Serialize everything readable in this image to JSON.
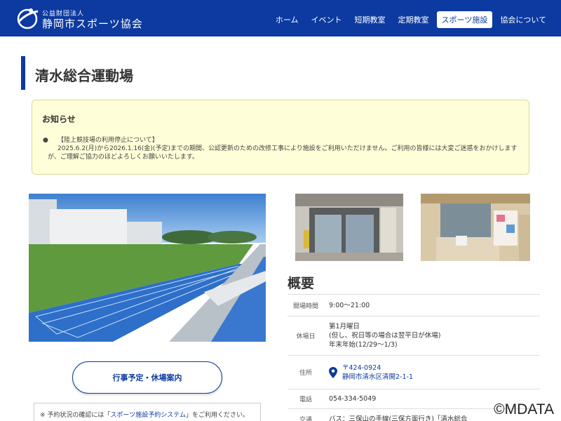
{
  "header": {
    "org_sub": "公益財団法人",
    "org_name": "静岡市スポーツ協会",
    "nav": [
      "ホーム",
      "イベント",
      "短期教室",
      "定期教室",
      "スポーツ施設",
      "協会について"
    ],
    "active_nav": "スポーツ施設"
  },
  "page": {
    "title": "清水総合運動場"
  },
  "notice": {
    "title": "お知らせ",
    "item_title": "【陸上競技場の利用停止について】",
    "item_line1": "2025.6.2(月)から2026.1.16(金)(予定)までの期間、公認更新のための改修工事により施設をご利用いただけません。ご利用の皆様には大変ご迷惑をおかけします",
    "item_line2": "が、ご理解ご協力のほどよろしくお願いいたします。"
  },
  "schedule_button": "行事予定・休場案内",
  "reserve": {
    "prefix": "※ 予約状況の確認には「",
    "link": "スポーツ施設予約システム",
    "suffix": "」をご利用ください。"
  },
  "overview": {
    "title": "概要",
    "rows": {
      "hours_label": "開場時間",
      "hours_value": "9:00～21:00",
      "closed_label": "休場日",
      "closed_line1": "第1月曜日",
      "closed_line2": "(但し、祝日等の場合は翌平日が休場)",
      "closed_line3": "年末年始(12/29～1/3)",
      "address_label": "住所",
      "postal": "〒424-0924",
      "address": "静岡市清水区清開2-1-1",
      "tel_label": "電話",
      "tel_value": "054-334-5049",
      "access_label": "交通",
      "access_value": "バス：三保山の手線(三保方面行き)「清水総合"
    }
  },
  "copyright": "©MDATA",
  "colors": {
    "brand_blue": "#0c3aa0",
    "notice_bg": "#fefed8"
  }
}
